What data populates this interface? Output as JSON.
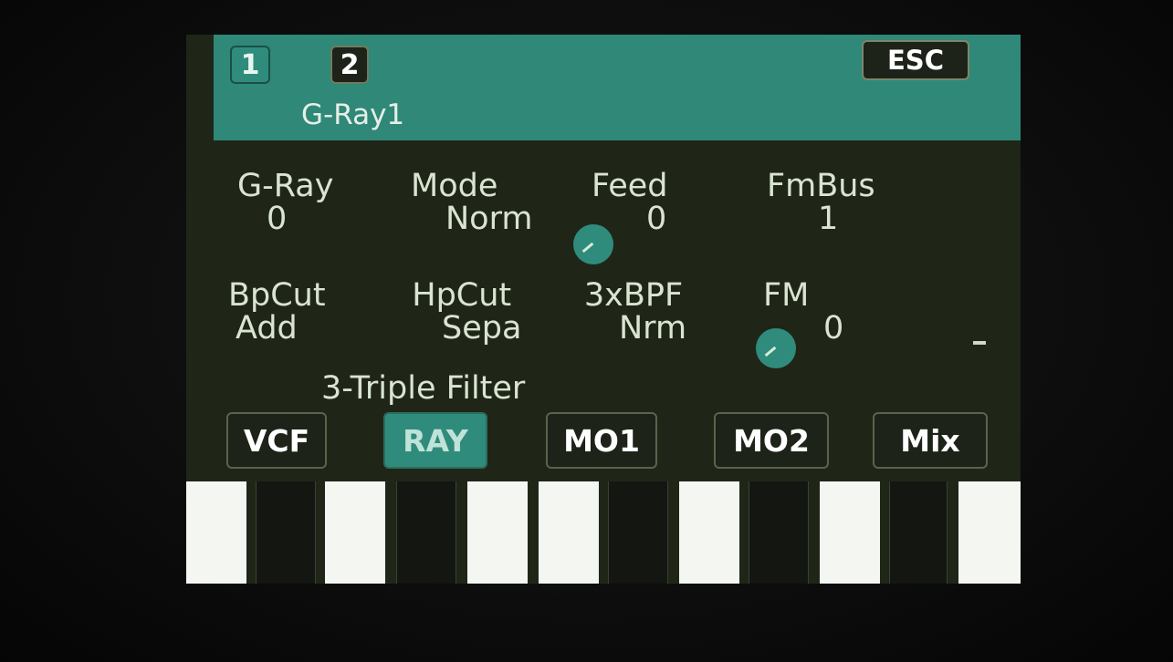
{
  "header": {
    "tabs": [
      "1",
      "2"
    ],
    "escape_label": "ESC",
    "patch_name": "G-Ray1",
    "colors": {
      "accent": "#2f8878",
      "background": "#202617"
    }
  },
  "params": {
    "row1": [
      {
        "name": "G-Ray",
        "value": "0"
      },
      {
        "name": "Mode",
        "value": "Norm"
      },
      {
        "name": "Feed",
        "value": "0"
      },
      {
        "name": "FmBus",
        "value": "1"
      }
    ],
    "row2": [
      {
        "name": "BpCut",
        "value": "Add"
      },
      {
        "name": "HpCut",
        "value": "Sepa"
      },
      {
        "name": "3xBPF",
        "value": "Nrm"
      },
      {
        "name": "FM",
        "value": "0"
      }
    ],
    "row2_extra": "-"
  },
  "preset_label": "3-Triple Filter",
  "pages": [
    {
      "label": "VCF",
      "active": false
    },
    {
      "label": "RAY",
      "active": true
    },
    {
      "label": "MO1",
      "active": false
    },
    {
      "label": "MO2",
      "active": false
    },
    {
      "label": "Mix",
      "active": false
    }
  ]
}
